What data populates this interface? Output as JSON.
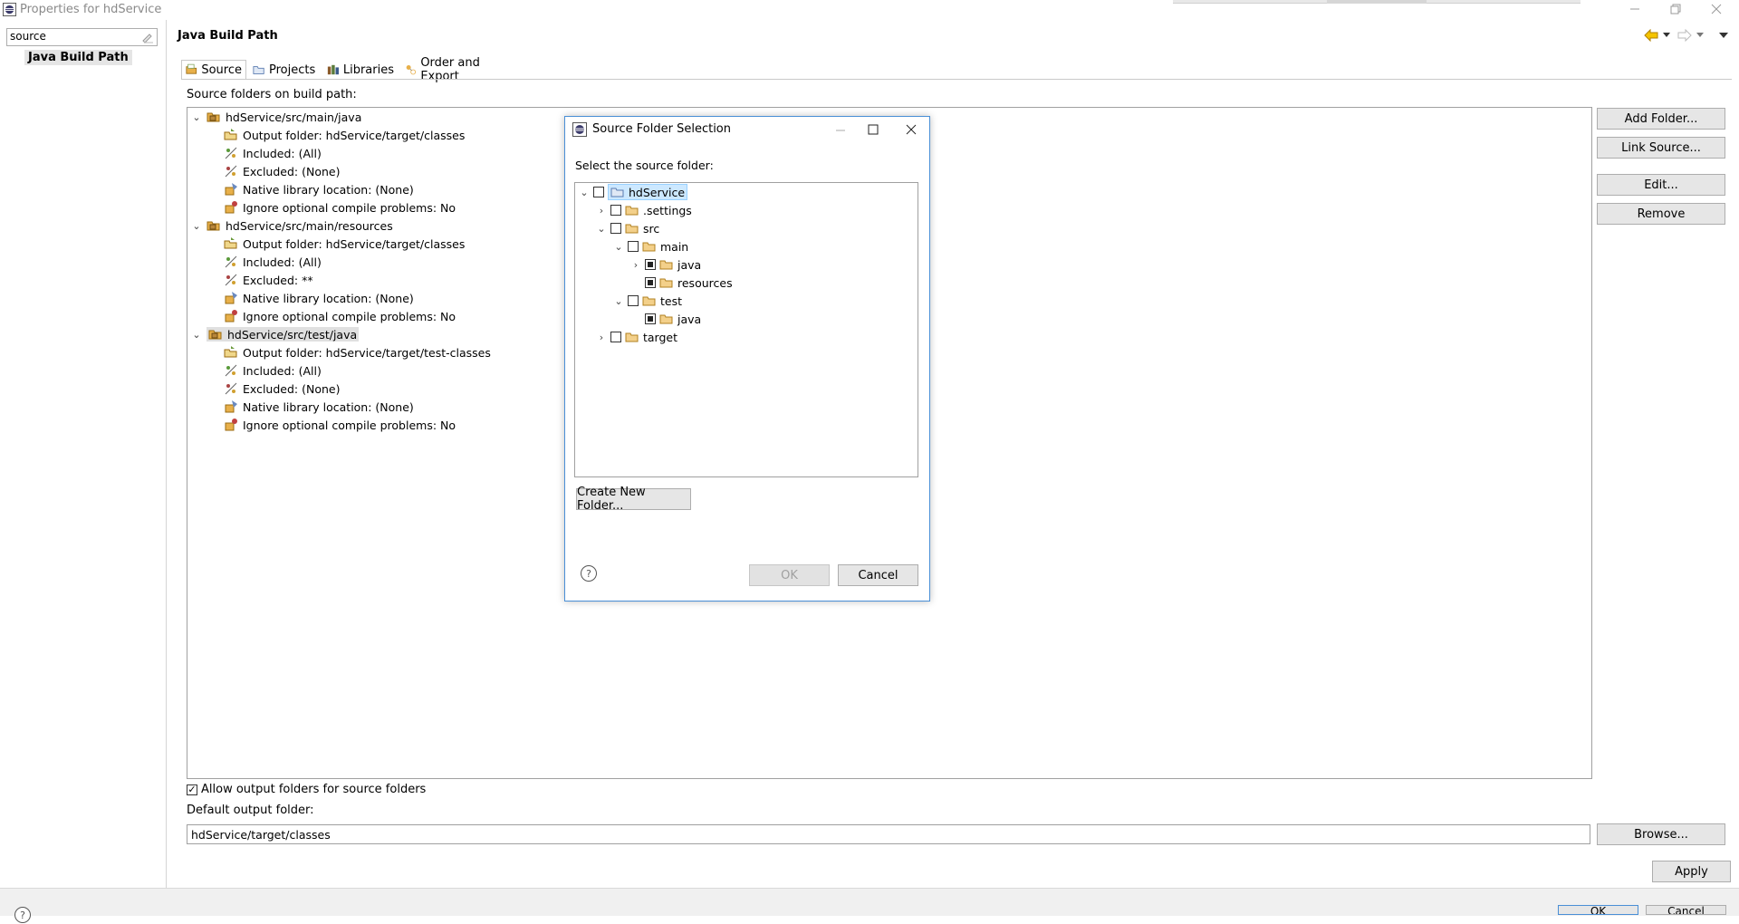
{
  "window": {
    "title": "Properties for hdService"
  },
  "left_nav": {
    "filter_value": "source",
    "items": [
      {
        "label": "Java Build Path"
      }
    ]
  },
  "page": {
    "title": "Java Build Path"
  },
  "tabs": [
    {
      "label": "Source",
      "active": true,
      "icon": "source-folder-icon"
    },
    {
      "label": "Projects",
      "active": false,
      "icon": "projects-icon"
    },
    {
      "label": "Libraries",
      "active": false,
      "icon": "libraries-icon"
    },
    {
      "label": "Order and Export",
      "active": false,
      "icon": "order-export-icon"
    }
  ],
  "source_panel": {
    "label": "Source folders on build path:",
    "folders": [
      {
        "name": "hdService/src/main/java",
        "selected": false,
        "children": [
          {
            "icon": "output-folder-icon",
            "text": "Output folder: hdService/target/classes"
          },
          {
            "icon": "included-icon",
            "text": "Included: (All)"
          },
          {
            "icon": "excluded-icon",
            "text": "Excluded: (None)"
          },
          {
            "icon": "native-library-icon",
            "text": "Native library location: (None)"
          },
          {
            "icon": "compile-problems-icon",
            "text": "Ignore optional compile problems: No"
          }
        ]
      },
      {
        "name": "hdService/src/main/resources",
        "selected": false,
        "children": [
          {
            "icon": "output-folder-icon",
            "text": "Output folder: hdService/target/classes"
          },
          {
            "icon": "included-icon",
            "text": "Included: (All)"
          },
          {
            "icon": "excluded-icon",
            "text": "Excluded: **"
          },
          {
            "icon": "native-library-icon",
            "text": "Native library location: (None)"
          },
          {
            "icon": "compile-problems-icon",
            "text": "Ignore optional compile problems: No"
          }
        ]
      },
      {
        "name": "hdService/src/test/java",
        "selected": true,
        "children": [
          {
            "icon": "output-folder-icon",
            "text": "Output folder: hdService/target/test-classes"
          },
          {
            "icon": "included-icon",
            "text": "Included: (All)"
          },
          {
            "icon": "excluded-icon",
            "text": "Excluded: (None)"
          },
          {
            "icon": "native-library-icon",
            "text": "Native library location: (None)"
          },
          {
            "icon": "compile-problems-icon",
            "text": "Ignore optional compile problems: No"
          }
        ]
      }
    ],
    "buttons": {
      "add_folder": "Add Folder...",
      "link_source": "Link Source...",
      "edit": "Edit...",
      "remove": "Remove"
    },
    "allow_output_label": "Allow output folders for source folders",
    "allow_output_checked": true,
    "default_output_label": "Default output folder:",
    "default_output_value": "hdService/target/classes",
    "browse": "Browse...",
    "apply": "Apply"
  },
  "bottom": {
    "ok_partial": "OK",
    "cancel_partial": "Cancel"
  },
  "dialog": {
    "title": "Source Folder Selection",
    "prompt": "Select the source folder:",
    "tree": [
      {
        "label": "hdService",
        "level": 0,
        "expand": "expanded",
        "check": "unchecked",
        "highlight": true
      },
      {
        "label": ".settings",
        "level": 1,
        "expand": "collapsed",
        "check": "unchecked"
      },
      {
        "label": "src",
        "level": 1,
        "expand": "expanded",
        "check": "unchecked"
      },
      {
        "label": "main",
        "level": 2,
        "expand": "expanded",
        "check": "unchecked"
      },
      {
        "label": "java",
        "level": 3,
        "expand": "collapsed",
        "check": "partial"
      },
      {
        "label": "resources",
        "level": 3,
        "expand": "none",
        "check": "partial"
      },
      {
        "label": "test",
        "level": 2,
        "expand": "expanded",
        "check": "unchecked"
      },
      {
        "label": "java",
        "level": 3,
        "expand": "none",
        "check": "partial"
      },
      {
        "label": "target",
        "level": 1,
        "expand": "collapsed",
        "check": "unchecked"
      }
    ],
    "create_folder": "Create New Folder...",
    "ok": "OK",
    "cancel": "Cancel"
  },
  "colors": {
    "accent_border": "#4a8fd6",
    "selection": "#cce8ff",
    "folder": "#e8b04a"
  }
}
